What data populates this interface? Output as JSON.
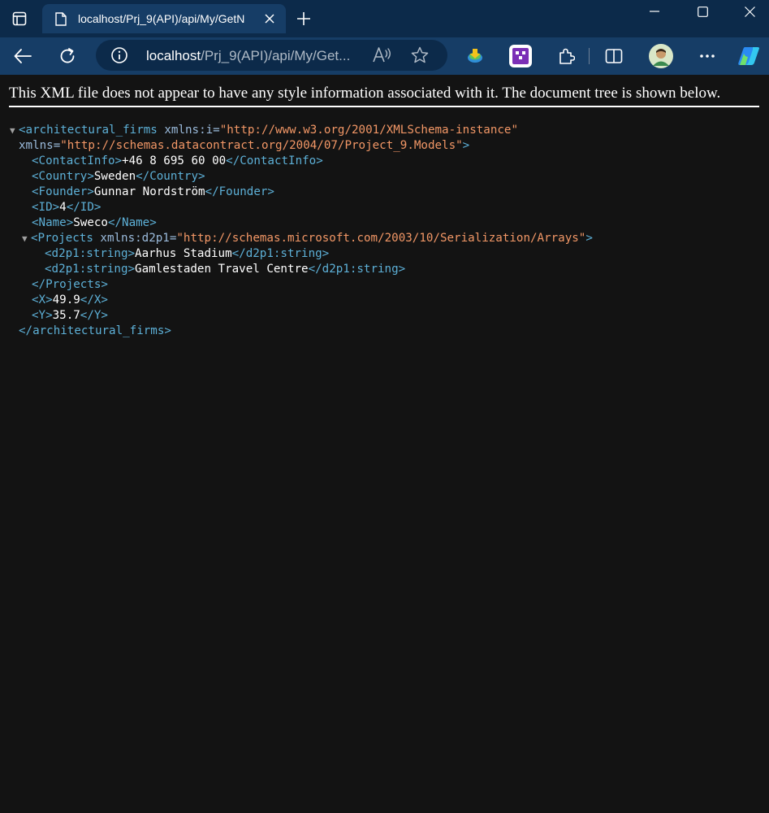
{
  "browser": {
    "tab_title": "localhost/Prj_9(API)/api/My/GetN",
    "url_host": "localhost",
    "url_path": "/Prj_9(API)/api/My/Get...",
    "new_tab_symbol": "+"
  },
  "icons": {
    "tab_actions": "tab-actions-icon",
    "favicon": "page-icon",
    "close": "close-icon",
    "new_tab": "plus-icon",
    "minimize": "minimize-icon",
    "maximize": "maximize-icon",
    "close_window": "close-window-icon",
    "back": "back-arrow-icon",
    "refresh": "refresh-icon",
    "info": "info-icon",
    "read_aloud": "read-aloud-icon",
    "favorite": "star-icon",
    "extension1": "idm-extension-icon",
    "extension2": "pixel-extension-icon",
    "extensions": "puzzle-icon",
    "split": "split-screen-icon",
    "profile": "avatar",
    "more": "more-icon",
    "copilot": "copilot-icon"
  },
  "colors": {
    "tabbar": "#0c2a4a",
    "toolbar": "#163d66",
    "page_bg": "#131313",
    "xml_tag": "#5db0d7",
    "xml_value": "#f29766"
  },
  "viewer": {
    "notice": "This XML file does not appear to have any style information associated with it. The document tree is shown below."
  },
  "xml": {
    "root_open": "<architectural_firms",
    "root_attr1_name": " xmlns:i=",
    "root_attr1_value": "\"http://www.w3.org/2001/XMLSchema-instance\"",
    "root_attr2_name": "xmlns=",
    "root_attr2_value": "\"http://schemas.datacontract.org/2004/07/Project_9.Models\"",
    "root_open_end": ">",
    "contact_open": "<ContactInfo>",
    "contact_value": "+46 8 695 60 00",
    "contact_close": "</ContactInfo>",
    "country_open": "<Country>",
    "country_value": "Sweden",
    "country_close": "</Country>",
    "founder_open": "<Founder>",
    "founder_value": "Gunnar Nordström",
    "founder_close": "</Founder>",
    "id_open": "<ID>",
    "id_value": "4",
    "id_close": "</ID>",
    "name_open": "<Name>",
    "name_value": "Sweco",
    "name_close": "</Name>",
    "projects_open": "<Projects",
    "projects_attr_name": " xmlns:d2p1=",
    "projects_attr_value": "\"http://schemas.microsoft.com/2003/10/Serialization/Arrays\"",
    "projects_open_end": ">",
    "string_open": "<d2p1:string>",
    "string_close": "</d2p1:string>",
    "project1": "Aarhus Stadium",
    "project2": "Gamlestaden Travel Centre",
    "projects_close": "</Projects>",
    "x_open": "<X>",
    "x_value": "49.9",
    "x_close": "</X>",
    "y_open": "<Y>",
    "y_value": "35.7",
    "y_close": "</Y>",
    "root_close": "</architectural_firms>",
    "collapse_symbol": "▼"
  }
}
